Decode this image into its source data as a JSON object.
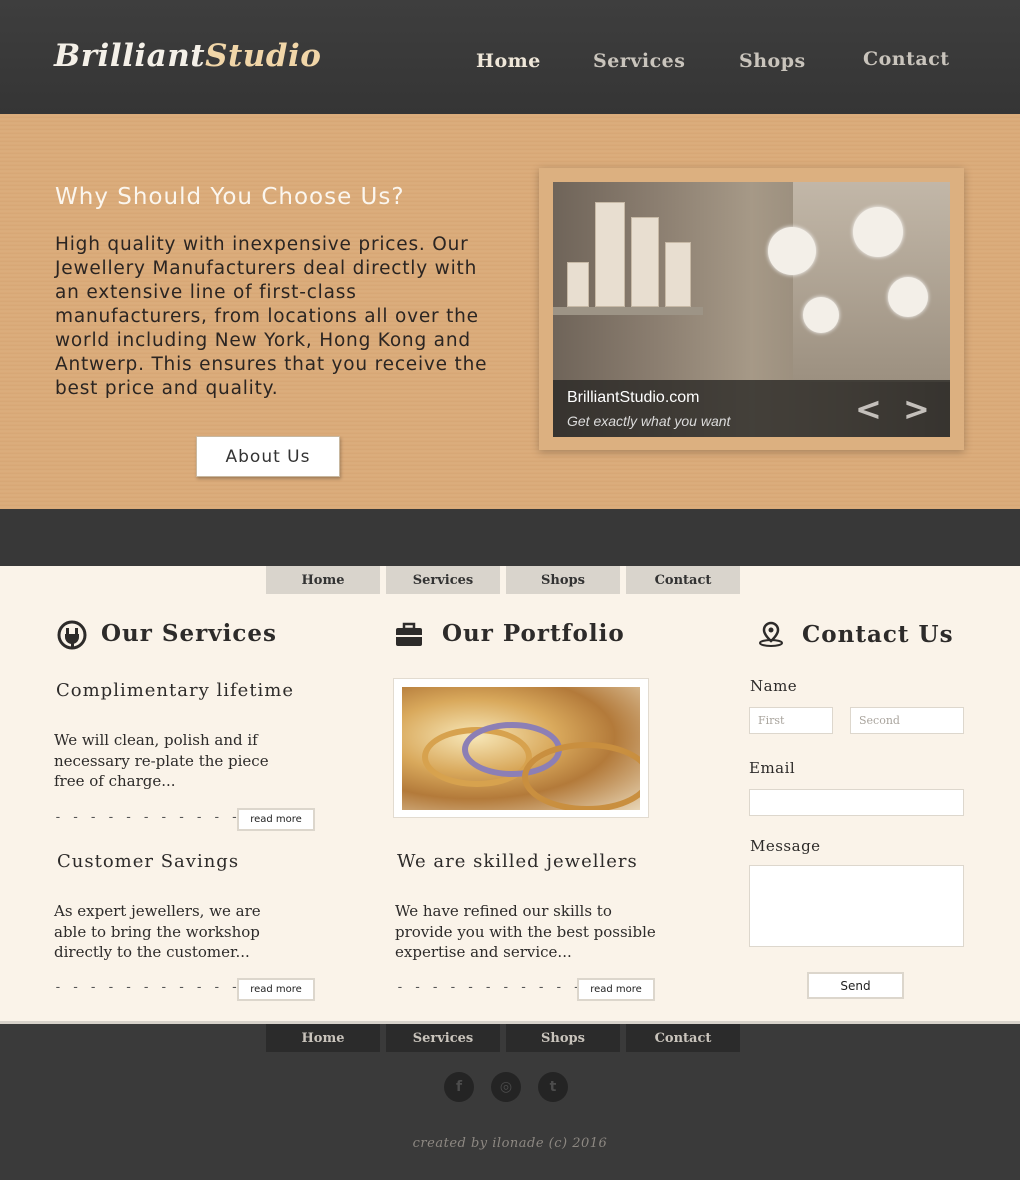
{
  "brand": {
    "part1": "Brilliant",
    "part2": "Studio"
  },
  "nav": [
    "Home",
    "Services",
    "Shops",
    "Contact"
  ],
  "hero": {
    "title": "Why Should You Choose Us?",
    "text": "High quality with inexpensive prices. Our Jewellery Manufacturers deal directly with an extensive line of first-class manufacturers, from locations all over the world including New York, Hong Kong and Antwerp. This ensures that you receive the best price and quality.",
    "button": "About Us"
  },
  "slider": {
    "caption_title": "BrilliantStudio.com",
    "caption_sub": "Get exactly what you want",
    "prev": "<",
    "next": ">"
  },
  "services": {
    "title": "Our Services",
    "items": [
      {
        "title": "Complimentary lifetime",
        "text": "We will clean, polish and if necessary re-plate the piece free of charge...",
        "button": "read more"
      },
      {
        "title": "Customer Savings",
        "text": "As expert jewellers, we are able to bring the workshop directly to the customer...",
        "button": "read more"
      }
    ]
  },
  "portfolio": {
    "title": "Our Portfolio",
    "item_title": "We are skilled jewellers",
    "item_text": "We have refined our skills to provide you with the best possible expertise and service...",
    "button": "read more"
  },
  "contact": {
    "title": "Contact Us",
    "name_label": "Name",
    "first_placeholder": "First",
    "second_placeholder": "Second",
    "email_label": "Email",
    "message_label": "Message",
    "send": "Send"
  },
  "dashes": "- - - - - - - - - - - - - -",
  "footer": {
    "social": [
      "f",
      "◎",
      "t"
    ],
    "credit": "created by ilonade (c) 2016"
  },
  "colors": {
    "accent": "#d9a877",
    "brand_highlight": "#f1d6a8",
    "content_bg": "#faf3e9",
    "dark": "#3a3a3a"
  }
}
